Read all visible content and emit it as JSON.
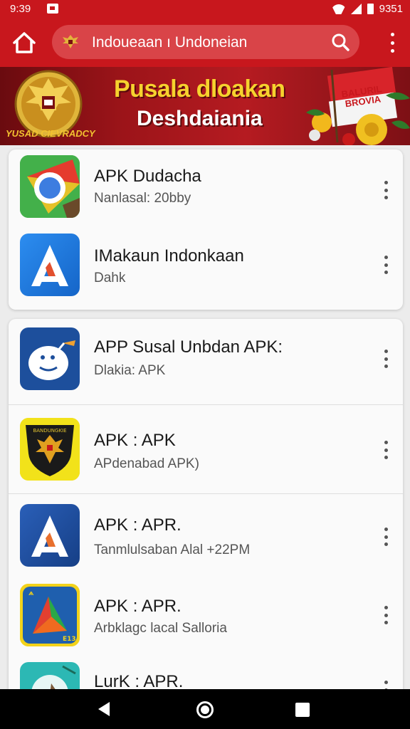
{
  "status_bar": {
    "time": "9:39",
    "battery_text": "9351"
  },
  "toolbar": {
    "url_text": "Indoueaan ı Undoneian"
  },
  "banner": {
    "title": "Pusala dloakan",
    "subtitle": "Deshdaiania",
    "emblem_caption": "YUSAD CIEVRADCY",
    "flag_text": "BALURIL BROVIA"
  },
  "apps_group_1": [
    {
      "title": "APK Dudacha",
      "subtitle": "Nanlasal: 20bby",
      "icon": "chrome-app-icon"
    },
    {
      "title": "IMakaun Indonkaan",
      "subtitle": "Dahk",
      "icon": "blue-a-app-icon"
    }
  ],
  "apps_group_2": [
    {
      "title": "APP Susal Unbdan APK:",
      "subtitle": "Dlakia: APK",
      "icon": "mascot-app-icon"
    },
    {
      "title": "APK : APK",
      "subtitle": "APdenabad APK)",
      "icon": "garuda-shield-app-icon"
    },
    {
      "title": "APK : APR.",
      "subtitle": "Tanmlulsaban Alal +22PM",
      "icon": "blue-a-app-icon"
    },
    {
      "title": "APK : APR.",
      "subtitle": "Arbklagc lacal Salloria",
      "icon": "triangle-app-icon"
    },
    {
      "title": "LurK : APR.",
      "subtitle": "",
      "icon": "teal-app-icon"
    }
  ],
  "colors": {
    "primary_red": "#c8171d",
    "banner_yellow": "#f6d22e"
  }
}
